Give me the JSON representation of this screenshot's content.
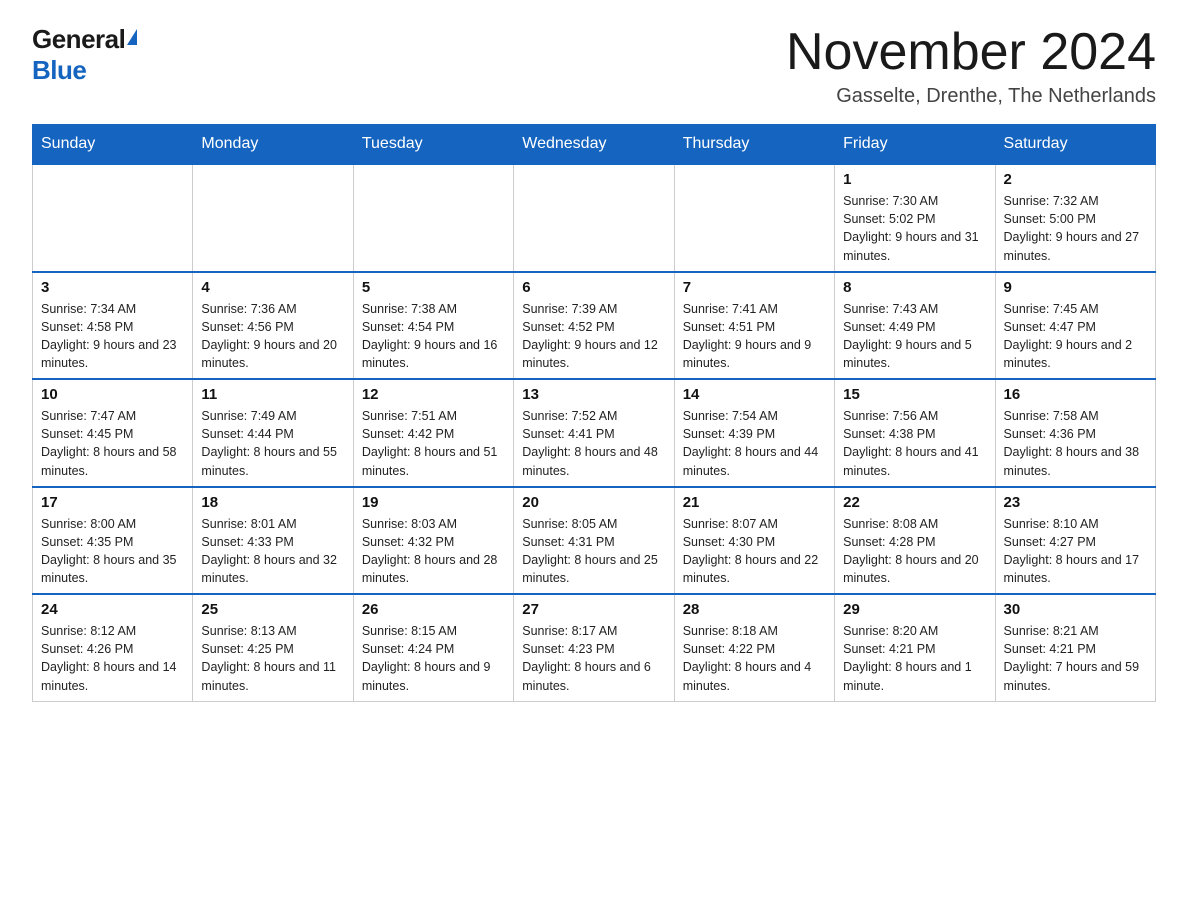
{
  "logo": {
    "general": "General",
    "blue": "Blue"
  },
  "header": {
    "month_year": "November 2024",
    "location": "Gasselte, Drenthe, The Netherlands"
  },
  "weekdays": [
    "Sunday",
    "Monday",
    "Tuesday",
    "Wednesday",
    "Thursday",
    "Friday",
    "Saturday"
  ],
  "weeks": [
    [
      {
        "day": "",
        "info": ""
      },
      {
        "day": "",
        "info": ""
      },
      {
        "day": "",
        "info": ""
      },
      {
        "day": "",
        "info": ""
      },
      {
        "day": "",
        "info": ""
      },
      {
        "day": "1",
        "info": "Sunrise: 7:30 AM\nSunset: 5:02 PM\nDaylight: 9 hours and 31 minutes."
      },
      {
        "day": "2",
        "info": "Sunrise: 7:32 AM\nSunset: 5:00 PM\nDaylight: 9 hours and 27 minutes."
      }
    ],
    [
      {
        "day": "3",
        "info": "Sunrise: 7:34 AM\nSunset: 4:58 PM\nDaylight: 9 hours and 23 minutes."
      },
      {
        "day": "4",
        "info": "Sunrise: 7:36 AM\nSunset: 4:56 PM\nDaylight: 9 hours and 20 minutes."
      },
      {
        "day": "5",
        "info": "Sunrise: 7:38 AM\nSunset: 4:54 PM\nDaylight: 9 hours and 16 minutes."
      },
      {
        "day": "6",
        "info": "Sunrise: 7:39 AM\nSunset: 4:52 PM\nDaylight: 9 hours and 12 minutes."
      },
      {
        "day": "7",
        "info": "Sunrise: 7:41 AM\nSunset: 4:51 PM\nDaylight: 9 hours and 9 minutes."
      },
      {
        "day": "8",
        "info": "Sunrise: 7:43 AM\nSunset: 4:49 PM\nDaylight: 9 hours and 5 minutes."
      },
      {
        "day": "9",
        "info": "Sunrise: 7:45 AM\nSunset: 4:47 PM\nDaylight: 9 hours and 2 minutes."
      }
    ],
    [
      {
        "day": "10",
        "info": "Sunrise: 7:47 AM\nSunset: 4:45 PM\nDaylight: 8 hours and 58 minutes."
      },
      {
        "day": "11",
        "info": "Sunrise: 7:49 AM\nSunset: 4:44 PM\nDaylight: 8 hours and 55 minutes."
      },
      {
        "day": "12",
        "info": "Sunrise: 7:51 AM\nSunset: 4:42 PM\nDaylight: 8 hours and 51 minutes."
      },
      {
        "day": "13",
        "info": "Sunrise: 7:52 AM\nSunset: 4:41 PM\nDaylight: 8 hours and 48 minutes."
      },
      {
        "day": "14",
        "info": "Sunrise: 7:54 AM\nSunset: 4:39 PM\nDaylight: 8 hours and 44 minutes."
      },
      {
        "day": "15",
        "info": "Sunrise: 7:56 AM\nSunset: 4:38 PM\nDaylight: 8 hours and 41 minutes."
      },
      {
        "day": "16",
        "info": "Sunrise: 7:58 AM\nSunset: 4:36 PM\nDaylight: 8 hours and 38 minutes."
      }
    ],
    [
      {
        "day": "17",
        "info": "Sunrise: 8:00 AM\nSunset: 4:35 PM\nDaylight: 8 hours and 35 minutes."
      },
      {
        "day": "18",
        "info": "Sunrise: 8:01 AM\nSunset: 4:33 PM\nDaylight: 8 hours and 32 minutes."
      },
      {
        "day": "19",
        "info": "Sunrise: 8:03 AM\nSunset: 4:32 PM\nDaylight: 8 hours and 28 minutes."
      },
      {
        "day": "20",
        "info": "Sunrise: 8:05 AM\nSunset: 4:31 PM\nDaylight: 8 hours and 25 minutes."
      },
      {
        "day": "21",
        "info": "Sunrise: 8:07 AM\nSunset: 4:30 PM\nDaylight: 8 hours and 22 minutes."
      },
      {
        "day": "22",
        "info": "Sunrise: 8:08 AM\nSunset: 4:28 PM\nDaylight: 8 hours and 20 minutes."
      },
      {
        "day": "23",
        "info": "Sunrise: 8:10 AM\nSunset: 4:27 PM\nDaylight: 8 hours and 17 minutes."
      }
    ],
    [
      {
        "day": "24",
        "info": "Sunrise: 8:12 AM\nSunset: 4:26 PM\nDaylight: 8 hours and 14 minutes."
      },
      {
        "day": "25",
        "info": "Sunrise: 8:13 AM\nSunset: 4:25 PM\nDaylight: 8 hours and 11 minutes."
      },
      {
        "day": "26",
        "info": "Sunrise: 8:15 AM\nSunset: 4:24 PM\nDaylight: 8 hours and 9 minutes."
      },
      {
        "day": "27",
        "info": "Sunrise: 8:17 AM\nSunset: 4:23 PM\nDaylight: 8 hours and 6 minutes."
      },
      {
        "day": "28",
        "info": "Sunrise: 8:18 AM\nSunset: 4:22 PM\nDaylight: 8 hours and 4 minutes."
      },
      {
        "day": "29",
        "info": "Sunrise: 8:20 AM\nSunset: 4:21 PM\nDaylight: 8 hours and 1 minute."
      },
      {
        "day": "30",
        "info": "Sunrise: 8:21 AM\nSunset: 4:21 PM\nDaylight: 7 hours and 59 minutes."
      }
    ]
  ]
}
